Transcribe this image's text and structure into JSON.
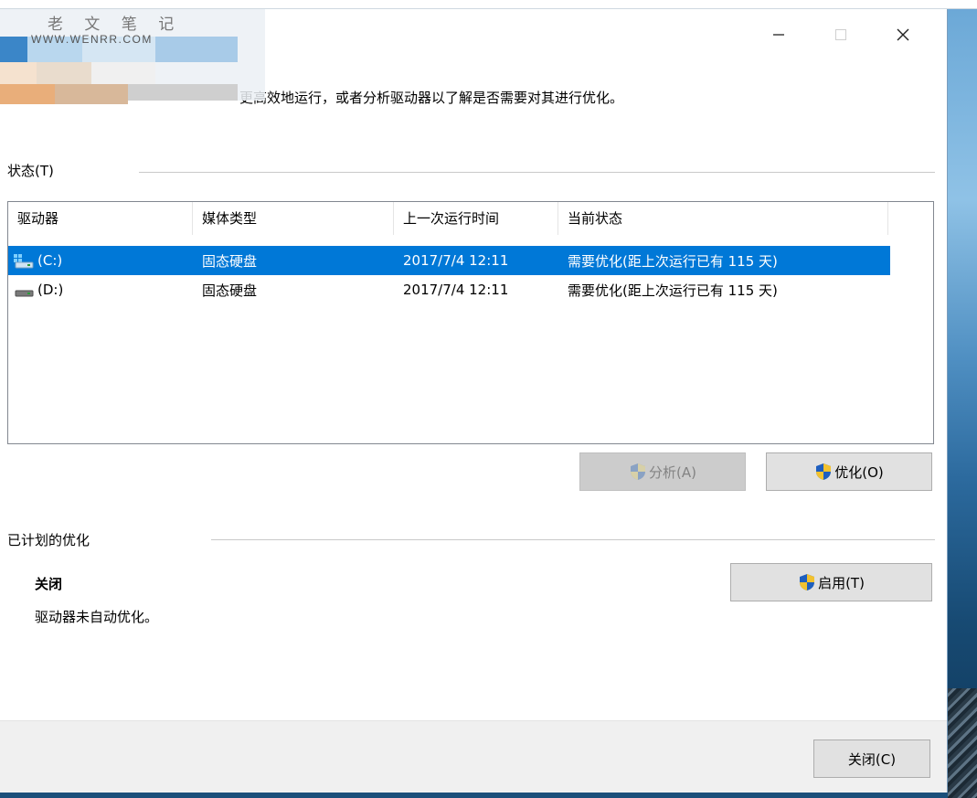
{
  "watermark": {
    "title": "老 文 笔 记",
    "url": "WWW.WENRR.COM"
  },
  "window": {
    "controls": {
      "minimize_icon": "minimize-icon",
      "maximize_icon": "maximize-icon",
      "close_icon": "close-icon"
    }
  },
  "description": "更高效地运行，或者分析驱动器以了解是否需要对其进行优化。",
  "status_section": {
    "label": "状态(T)",
    "columns": [
      "驱动器",
      "媒体类型",
      "上一次运行时间",
      "当前状态"
    ],
    "rows": [
      {
        "drive": "(C:)",
        "media": "固态硬盘",
        "last_run": "2017/7/4 12:11",
        "status": "需要优化(距上次运行已有 115 天)",
        "selected": true,
        "icon": "system-drive-icon"
      },
      {
        "drive": "(D:)",
        "media": "固态硬盘",
        "last_run": "2017/7/4 12:11",
        "status": "需要优化(距上次运行已有 115 天)",
        "selected": false,
        "icon": "drive-icon"
      }
    ],
    "analyze_button": "分析(A)",
    "optimize_button": "优化(O)"
  },
  "schedule_section": {
    "label": "已计划的优化",
    "state": "关闭",
    "state_desc": "驱动器未自动优化。",
    "enable_button": "启用(T)"
  },
  "footer": {
    "close_button": "关闭(C)"
  },
  "colors": {
    "selection": "#0078d7",
    "button_face": "#e1e1e1",
    "footer_bg": "#f0f0f0",
    "shield_blue": "#1f5fbf",
    "shield_yellow": "#f2c230"
  }
}
